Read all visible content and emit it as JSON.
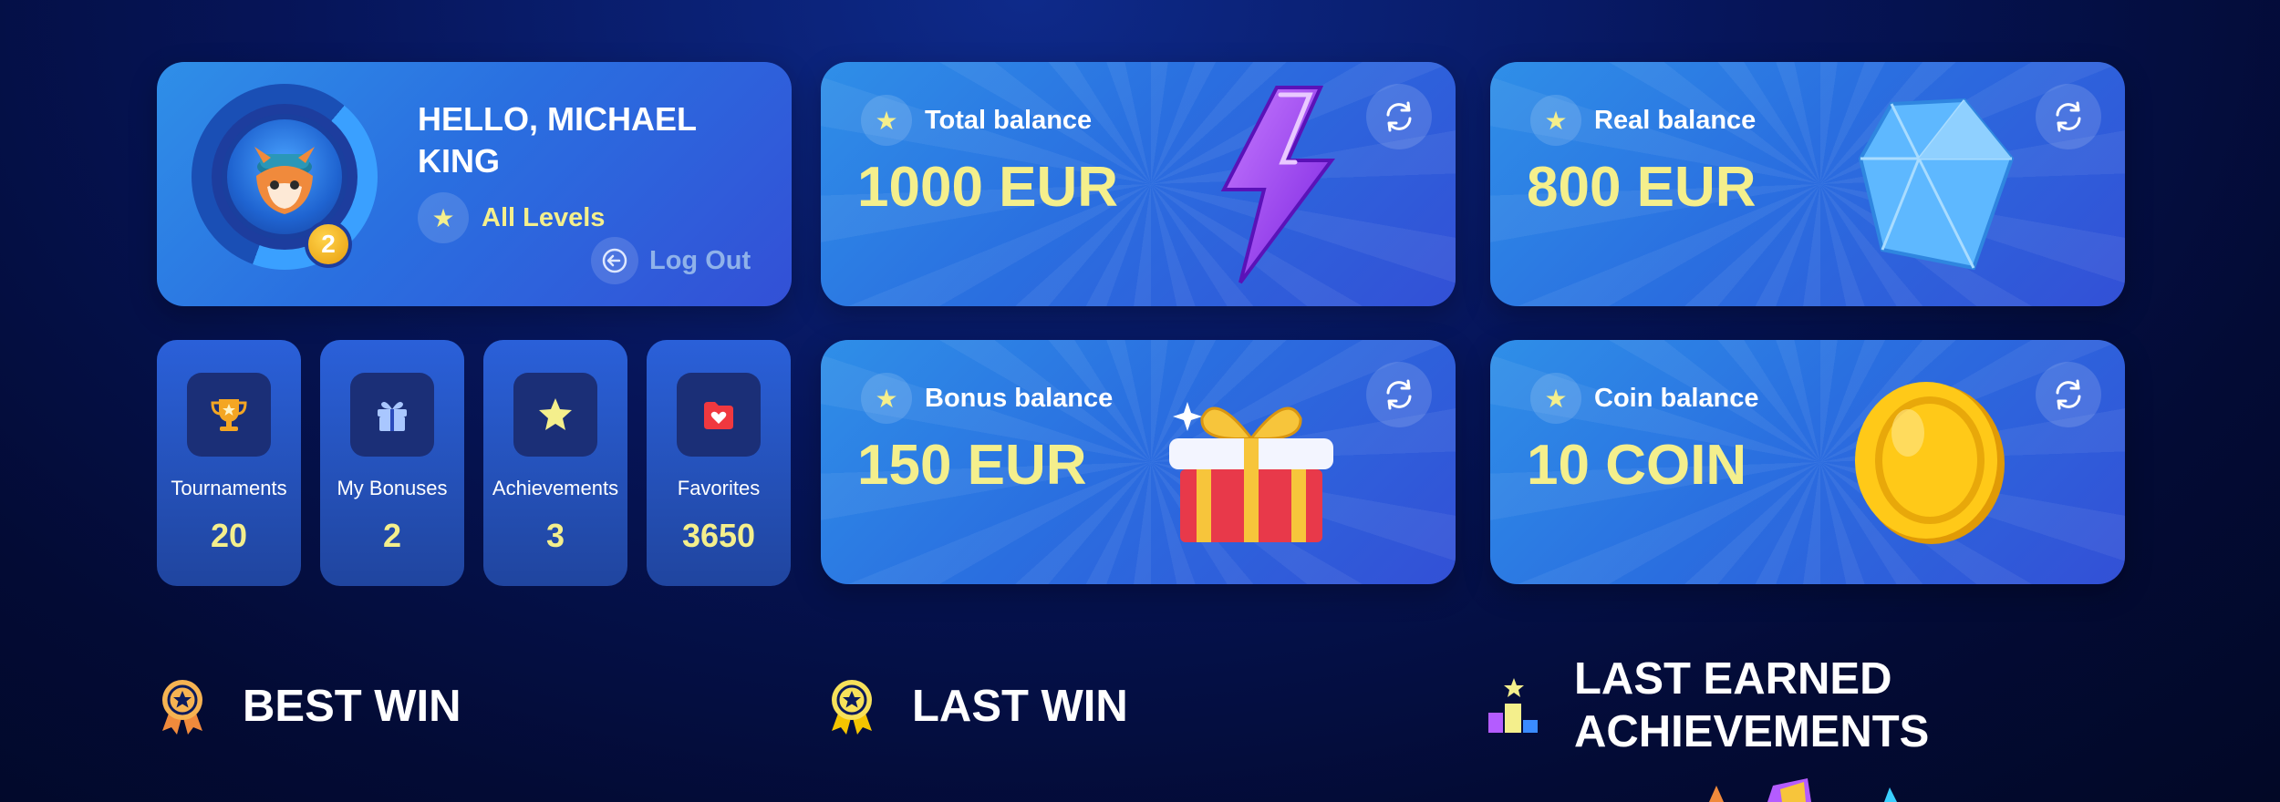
{
  "profile": {
    "greeting": "HELLO, MICHAEL KING",
    "level": "2",
    "levels_link": "All Levels",
    "logout": "Log Out"
  },
  "stats": [
    {
      "label": "Tournaments",
      "value": "20",
      "icon": "trophy-icon"
    },
    {
      "label": "My Bonuses",
      "value": "2",
      "icon": "gift-icon"
    },
    {
      "label": "Achievements",
      "value": "3",
      "icon": "star-icon"
    },
    {
      "label": "Favorites",
      "value": "3650",
      "icon": "heart-folder-icon"
    }
  ],
  "balances": {
    "total": {
      "label": "Total balance",
      "amount": "1000 EUR",
      "art": "lightning-icon"
    },
    "real": {
      "label": "Real balance",
      "amount": "800 EUR",
      "art": "diamond-icon"
    },
    "bonus": {
      "label": "Bonus balance",
      "amount": "150 EUR",
      "art": "gift-box-icon"
    },
    "coin": {
      "label": "Coin balance",
      "amount": "10 COIN",
      "art": "coin-icon"
    }
  },
  "sections": {
    "best_win": "BEST WIN",
    "last_win": "LAST WIN",
    "last_achievements": "LAST EARNED ACHIEVEMENTS"
  },
  "colors": {
    "accent_yellow": "#f4ef8c",
    "card_blue": "#2a6fe0",
    "background": "#06155a"
  }
}
